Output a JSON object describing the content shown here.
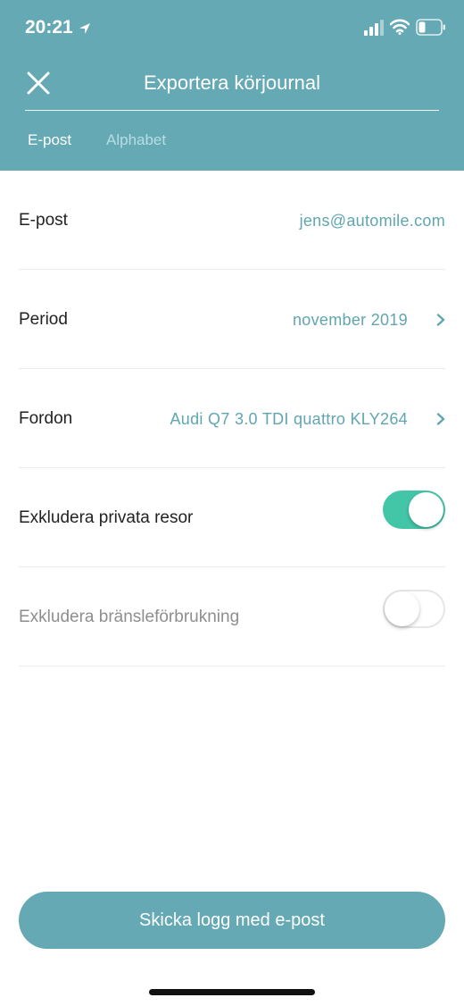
{
  "status": {
    "time": "20:21"
  },
  "header": {
    "title": "Exportera körjournal",
    "tabs": [
      {
        "label": "E-post",
        "active": true
      },
      {
        "label": "Alphabet",
        "active": false
      }
    ]
  },
  "rows": {
    "email": {
      "label": "E-post",
      "value": "jens@automile.com"
    },
    "period": {
      "label": "Period",
      "value": "november 2019"
    },
    "vehicle": {
      "label": "Fordon",
      "value": "Audi Q7 3.0 TDI quattro KLY264"
    },
    "exclude_private": {
      "label": "Exkludera privata resor",
      "enabled": true
    },
    "exclude_fuel": {
      "label": "Exkludera bränsleförbrukning",
      "enabled": false
    }
  },
  "footer": {
    "send_label": "Skicka logg med e-post"
  },
  "colors": {
    "accent": "#64a9b3",
    "toggle_on": "#43c6a8",
    "value_text": "#5fa6b1"
  },
  "icons": [
    "location-arrow-icon",
    "cellular-signal-icon",
    "wifi-icon",
    "battery-icon",
    "close-icon",
    "chevron-right-icon"
  ]
}
